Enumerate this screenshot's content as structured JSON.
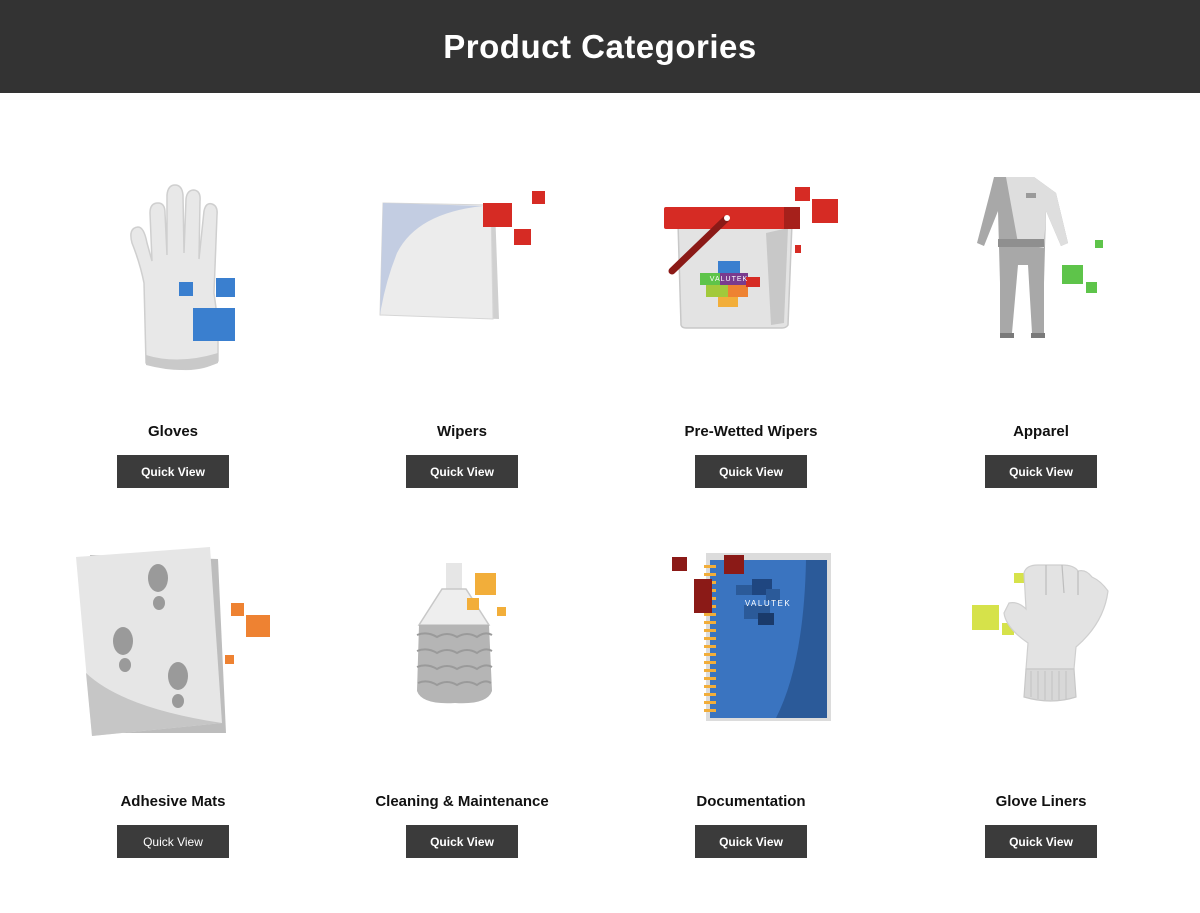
{
  "header": {
    "title": "Product Categories"
  },
  "brand": {
    "logo_text": "VALUTEK"
  },
  "categories": [
    {
      "name": "Gloves",
      "button": "Quick View",
      "icon": "glove-icon",
      "accent": "#3a7fcf"
    },
    {
      "name": "Wipers",
      "button": "Quick View",
      "icon": "wiper-icon",
      "accent": "#d62b24"
    },
    {
      "name": "Pre-Wetted Wipers",
      "button": "Quick View",
      "icon": "bucket-icon",
      "accent": "#d62b24"
    },
    {
      "name": "Apparel",
      "button": "Quick View",
      "icon": "coverall-icon",
      "accent": "#5ec44a"
    },
    {
      "name": "Adhesive Mats",
      "button": "Quick View",
      "icon": "adhesive-mat-icon",
      "accent": "#ee8232"
    },
    {
      "name": "Cleaning & Maintenance",
      "button": "Quick View",
      "icon": "mop-icon",
      "accent": "#f2ae3a"
    },
    {
      "name": "Documentation",
      "button": "Quick View",
      "icon": "notebook-icon",
      "accent": "#8b1a17"
    },
    {
      "name": "Glove Liners",
      "button": "Quick View",
      "icon": "glove-liner-icon",
      "accent": "#d6e24a"
    }
  ]
}
